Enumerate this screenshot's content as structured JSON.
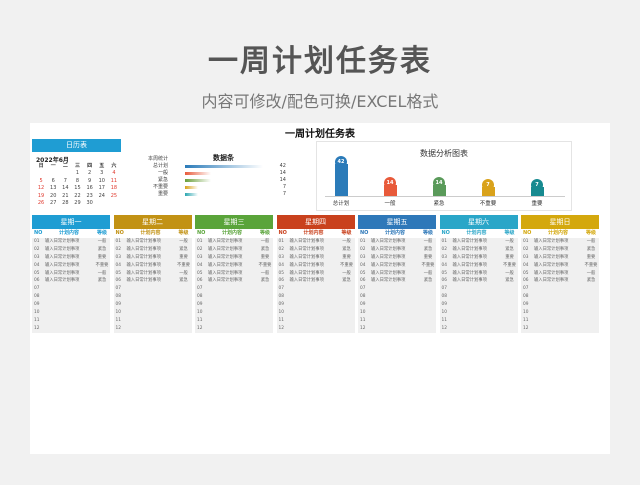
{
  "page": {
    "title": "一周计划任务表",
    "subtitle": "内容可修改/配色可换/EXCEL格式"
  },
  "sheet": {
    "title": "一周计划任务表"
  },
  "calendar": {
    "header": "日历表",
    "month": "2022年6月",
    "weekdays": [
      "日",
      "一",
      "二",
      "三",
      "四",
      "五",
      "六"
    ],
    "weeks": [
      [
        "",
        "",
        "",
        "1",
        "2",
        "3",
        "4"
      ],
      [
        "5",
        "6",
        "7",
        "8",
        "9",
        "10",
        "11"
      ],
      [
        "12",
        "13",
        "14",
        "15",
        "16",
        "17",
        "18"
      ],
      [
        "19",
        "20",
        "21",
        "22",
        "23",
        "24",
        "25"
      ],
      [
        "26",
        "27",
        "28",
        "29",
        "30",
        "",
        ""
      ]
    ],
    "weekend_color": "#e03a2f"
  },
  "stats": {
    "label_header": "本周统计",
    "bar_header": "数据条",
    "rows": [
      {
        "name": "总计划",
        "value": "42",
        "fraction": 1.0,
        "color": "#2b7bb9"
      },
      {
        "name": "一般",
        "value": "14",
        "fraction": 0.33,
        "color": "#e85a3a"
      },
      {
        "name": "紧急",
        "value": "14",
        "fraction": 0.33,
        "color": "#6a9f3a"
      },
      {
        "name": "不重要",
        "value": "7",
        "fraction": 0.17,
        "color": "#d9a21b"
      },
      {
        "name": "重要",
        "value": "7",
        "fraction": 0.17,
        "color": "#2aa6b0"
      }
    ]
  },
  "chart_data": {
    "type": "bar",
    "title": "数据分析图表",
    "categories": [
      "总计划",
      "一般",
      "紧急",
      "不重要",
      "重要"
    ],
    "values": [
      42,
      14,
      14,
      7,
      7
    ],
    "colors": [
      "#2b7bb9",
      "#e85a3a",
      "#5a9a5a",
      "#d9a21b",
      "#178a90"
    ],
    "ylim": [
      0,
      42
    ],
    "grid": false
  },
  "days": [
    {
      "name": "星期一",
      "color": "#1f9dd3",
      "text_color": "#1f9dd3",
      "tasks": 6
    },
    {
      "name": "星期二",
      "color": "#c29214",
      "text_color": "#c29214",
      "tasks": 6
    },
    {
      "name": "星期三",
      "color": "#5aa43a",
      "text_color": "#5aa43a",
      "tasks": 6
    },
    {
      "name": "星期四",
      "color": "#c9411d",
      "text_color": "#c9411d",
      "tasks": 6
    },
    {
      "name": "星期五",
      "color": "#2e78b9",
      "text_color": "#2e78b9",
      "tasks": 6
    },
    {
      "name": "星期六",
      "color": "#2aa6c8",
      "text_color": "#2aa6c8",
      "tasks": 6
    },
    {
      "name": "星期日",
      "color": "#d4a80d",
      "text_color": "#d4a80d",
      "tasks": 6
    }
  ],
  "columns": {
    "no": "NO",
    "content": "计划内容",
    "level": "等级"
  },
  "row_numbers": [
    "01",
    "02",
    "03",
    "04",
    "05",
    "06",
    "07",
    "08",
    "09",
    "10",
    "11",
    "12"
  ],
  "task_text": "输入日常计划事项",
  "levels": [
    "一般",
    "紧急",
    "重要",
    "不重要",
    "一般",
    "紧急"
  ]
}
